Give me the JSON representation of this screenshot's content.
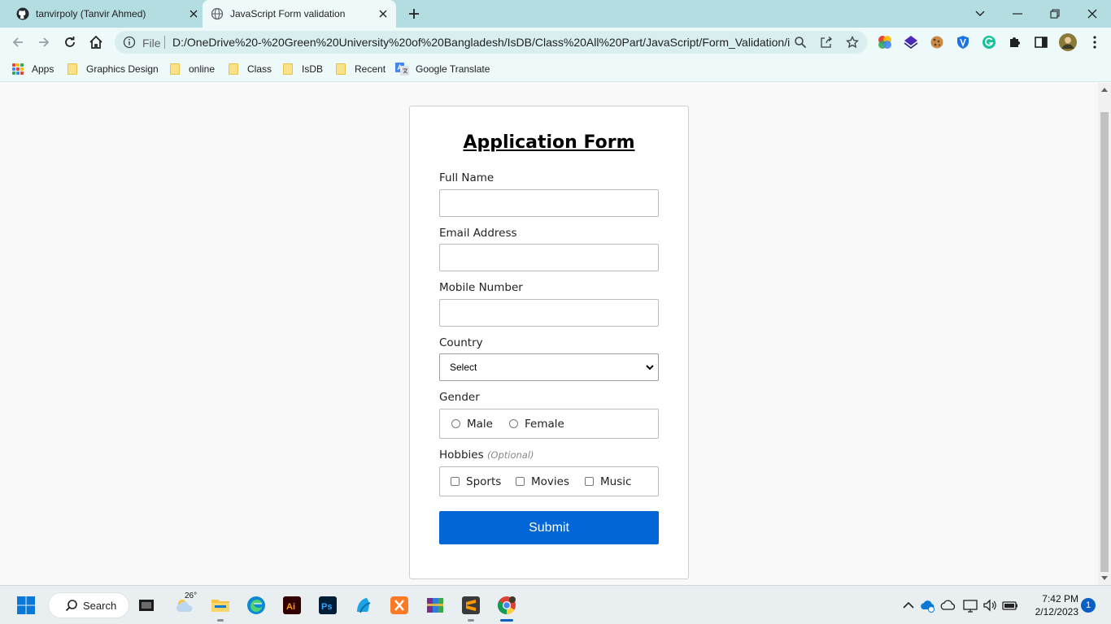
{
  "browser": {
    "tabs": [
      {
        "title": "tanvirpoly (Tanvir Ahmed)",
        "icon": "github-icon"
      },
      {
        "title": "JavaScript Form validation",
        "icon": "globe-icon"
      }
    ],
    "omnibox": {
      "scheme_label": "File",
      "url": "D:/OneDrive%20-%20Green%20University%20of%20Bangladesh/IsDB/Class%20All%20Part/JavaScript/Form_Validation/i..."
    },
    "bookmarks": [
      {
        "label": "Apps",
        "icon": "apps-grid-icon"
      },
      {
        "label": "Graphics Design",
        "icon": "folder-icon"
      },
      {
        "label": "online",
        "icon": "folder-icon"
      },
      {
        "label": "Class",
        "icon": "folder-icon"
      },
      {
        "label": "IsDB",
        "icon": "folder-icon"
      },
      {
        "label": "Recent",
        "icon": "folder-icon"
      },
      {
        "label": "Google Translate",
        "icon": "google-translate-icon"
      }
    ]
  },
  "form": {
    "title": "Application Form",
    "fields": {
      "full_name": {
        "label": "Full Name",
        "value": ""
      },
      "email": {
        "label": "Email Address",
        "value": ""
      },
      "mobile": {
        "label": "Mobile Number",
        "value": ""
      },
      "country": {
        "label": "Country",
        "selected": "Select"
      },
      "gender": {
        "label": "Gender",
        "options": [
          "Male",
          "Female"
        ]
      },
      "hobbies": {
        "label": "Hobbies",
        "hint": "(Optional)",
        "options": [
          "Sports",
          "Movies",
          "Music"
        ]
      }
    },
    "submit_label": "Submit"
  },
  "taskbar": {
    "search_label": "Search",
    "weather_temp": "26°",
    "time": "7:42 PM",
    "date": "2/12/2023",
    "notification_count": "1"
  },
  "colors": {
    "tabstrip": "#b3dde0",
    "toolbar": "#eef9fa",
    "submit_button": "#0366d6"
  }
}
